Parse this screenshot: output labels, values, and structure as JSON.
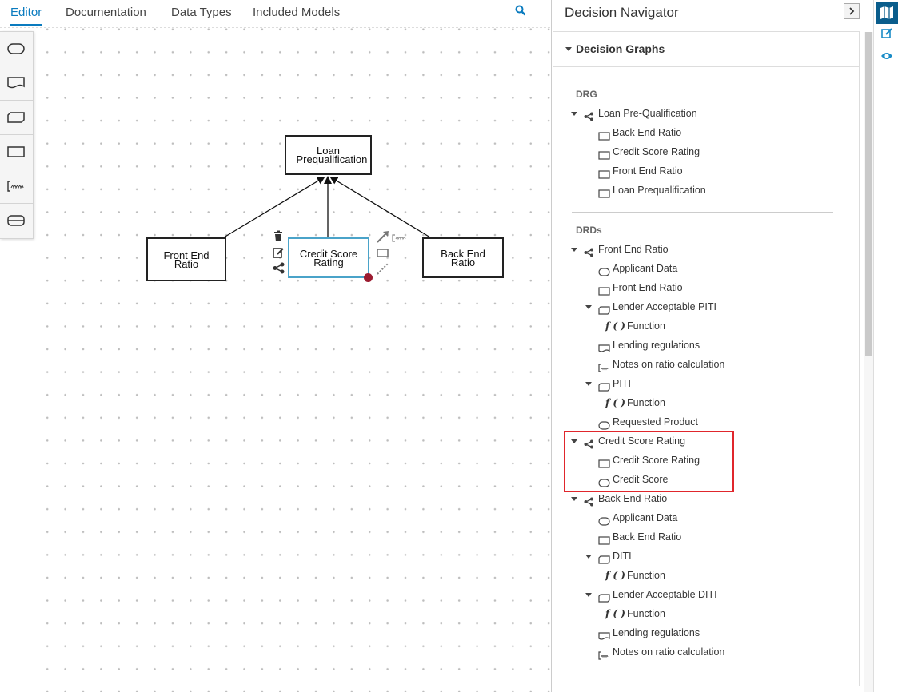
{
  "tabs": [
    {
      "label": "Editor"
    },
    {
      "label": "Documentation"
    },
    {
      "label": "Data Types"
    },
    {
      "label": "Included Models"
    }
  ],
  "icons": {
    "search": "search-icon",
    "palette": [
      "input-data-icon",
      "knowledge-source-icon",
      "business-knowledge-model-icon",
      "decision-icon",
      "text-annotation-icon",
      "decision-service-icon"
    ],
    "node_controls": [
      "trash-icon",
      "edit-icon",
      "share-icon",
      "connector-arrow-icon",
      "annotation-icon",
      "decision-node-icon",
      "dashed-connector-icon"
    ],
    "sidebar": [
      "map-icon",
      "edit-icon",
      "eye-icon"
    ]
  },
  "colors": {
    "accent": "#0a7bbf",
    "selected_node_border": "#4aa3c9",
    "highlight": "#e0262c",
    "connector_dot": "#9b1b30",
    "sidebar_active": "#0a5d8c"
  },
  "canvas": {
    "nodes": {
      "loan": "Loan Prequalification",
      "front": "Front End Ratio",
      "credit": "Credit Score Rating",
      "back": "Back End Ratio"
    }
  },
  "navigator": {
    "title": "Decision Navigator",
    "section": "Decision Graphs",
    "drg_label": "DRG",
    "drds_label": "DRDs",
    "rows": [
      {
        "label": "Loan Pre-Qualification",
        "icon": "graph"
      },
      {
        "label": "Back End Ratio",
        "icon": "decision"
      },
      {
        "label": "Credit Score Rating",
        "icon": "decision"
      },
      {
        "label": "Front End Ratio",
        "icon": "decision"
      },
      {
        "label": "Loan Prequalification",
        "icon": "decision"
      },
      {
        "label": "Front End Ratio",
        "icon": "graph"
      },
      {
        "label": "Applicant Data",
        "icon": "input"
      },
      {
        "label": "Front End Ratio",
        "icon": "decision"
      },
      {
        "label": "Lender Acceptable PITI",
        "icon": "bkm"
      },
      {
        "label": "Function",
        "icon": "function",
        "fn_glyph": "f ( )"
      },
      {
        "label": "Lending regulations",
        "icon": "knowledge"
      },
      {
        "label": "Notes on ratio calculation",
        "icon": "annotation"
      },
      {
        "label": "PITI",
        "icon": "bkm"
      },
      {
        "label": "Function",
        "icon": "function",
        "fn_glyph": "f ( )"
      },
      {
        "label": "Requested Product",
        "icon": "input"
      },
      {
        "label": "Credit Score Rating",
        "icon": "graph"
      },
      {
        "label": "Credit Score Rating",
        "icon": "decision"
      },
      {
        "label": "Credit Score",
        "icon": "input"
      },
      {
        "label": "Back End Ratio",
        "icon": "graph"
      },
      {
        "label": "Applicant Data",
        "icon": "input"
      },
      {
        "label": "Back End Ratio",
        "icon": "decision"
      },
      {
        "label": "DITI",
        "icon": "bkm"
      },
      {
        "label": "Function",
        "icon": "function",
        "fn_glyph": "f ( )"
      },
      {
        "label": "Lender Acceptable DITI",
        "icon": "bkm"
      },
      {
        "label": "Function",
        "icon": "function",
        "fn_glyph": "f ( )"
      },
      {
        "label": "Lending regulations",
        "icon": "knowledge"
      },
      {
        "label": "Notes on ratio calculation",
        "icon": "annotation"
      }
    ]
  }
}
